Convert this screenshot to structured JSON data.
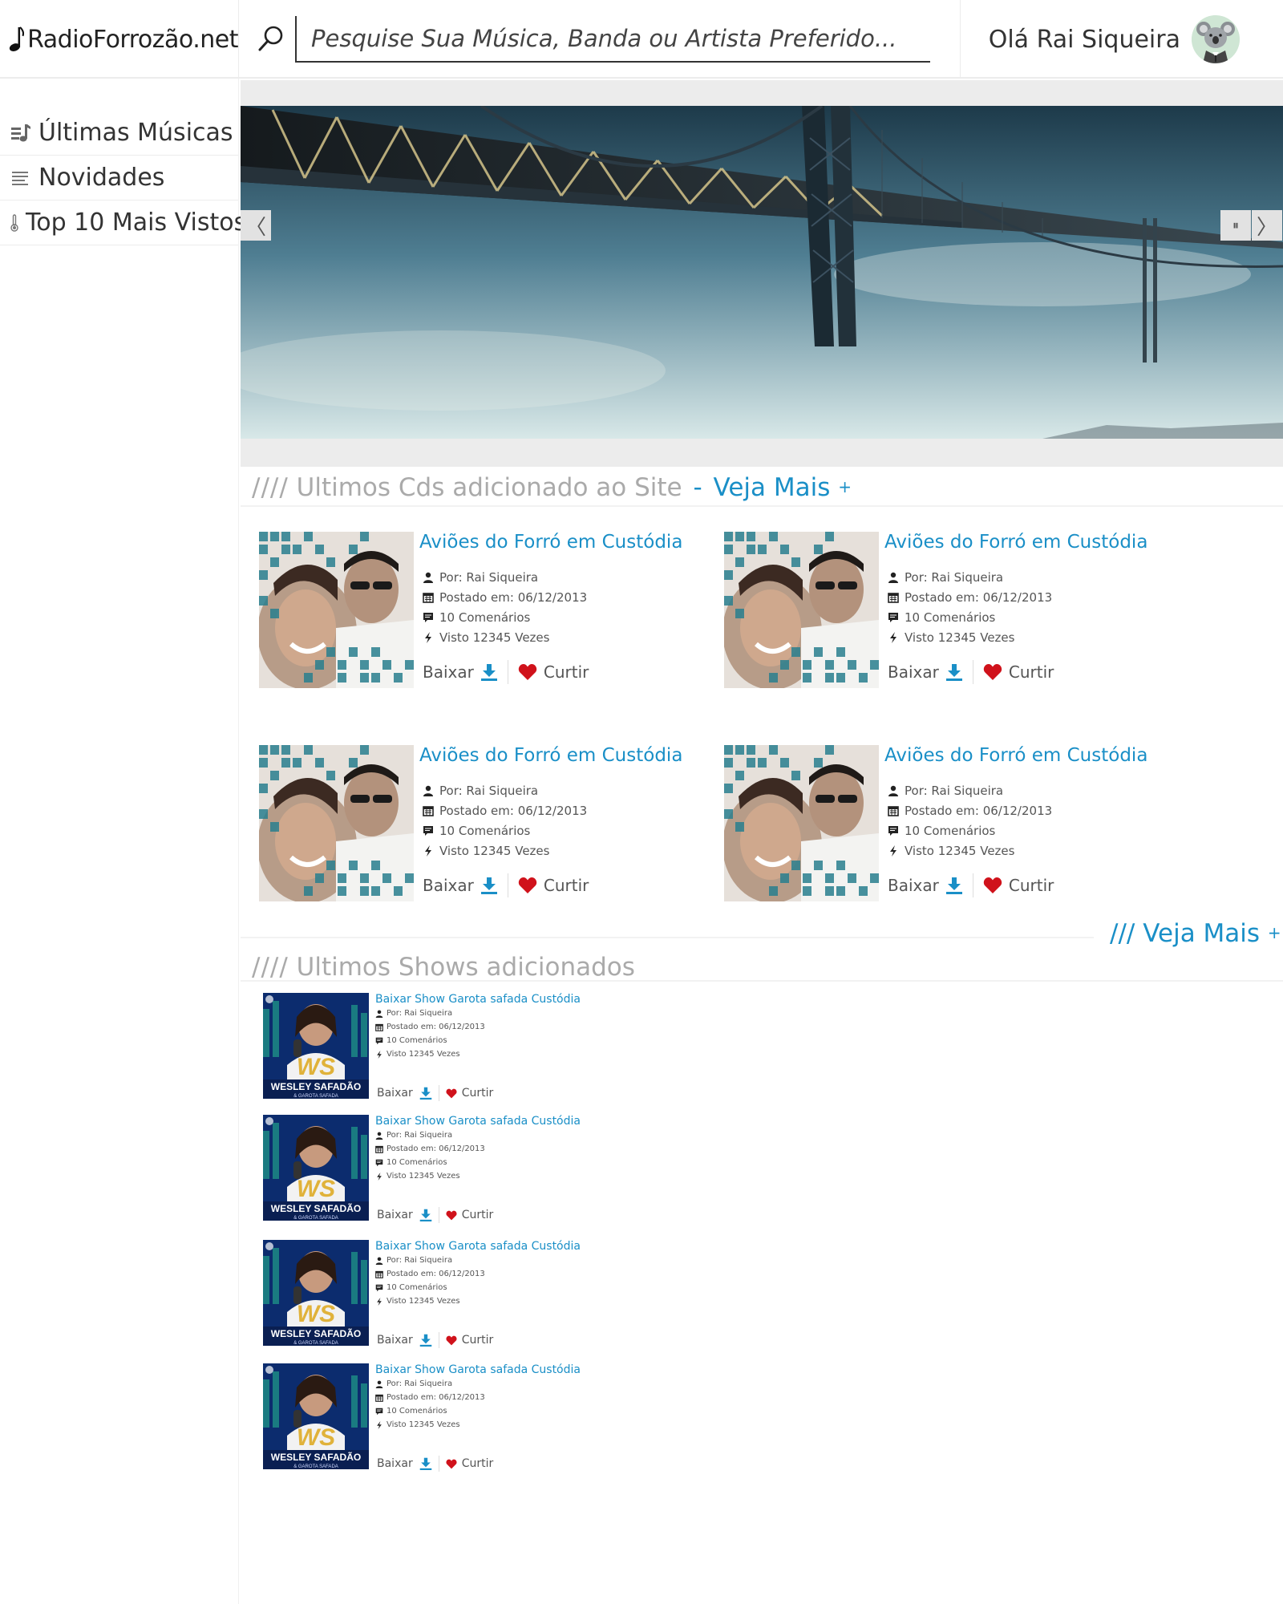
{
  "brand": {
    "name": "RadioForrozão.net",
    "note_icon": "music-note-icon"
  },
  "search": {
    "placeholder": "Pesquise Sua Música, Banda ou Artista Preferido..."
  },
  "user": {
    "greeting": "Olá Rai Siqueira"
  },
  "sidebar": {
    "items": [
      {
        "label": "Últimas Músicas",
        "icon": "music-list-icon"
      },
      {
        "label": "Novidades",
        "icon": "lines-icon"
      },
      {
        "label": "Top 10 Mais Vistos",
        "icon": "thermometer-icon"
      }
    ]
  },
  "slider": {
    "prev": "〈",
    "pause": "⏸",
    "next": "〉"
  },
  "cds_section": {
    "slashes": "////",
    "title": "Ultimos Cds adicionado ao Site",
    "dash": "-",
    "more_label": "Veja Mais",
    "plus": "+"
  },
  "cds": [
    {
      "title": "Aviões do Forró em Custódia",
      "author": "Por: Rai Siqueira",
      "date": "Postado em: 06/12/2013",
      "comments": "10 Comenários",
      "views": "Visto 12345 Vezes",
      "download": "Baixar",
      "like": "Curtir"
    },
    {
      "title": "Aviões do Forró em Custódia",
      "author": "Por: Rai Siqueira",
      "date": "Postado em: 06/12/2013",
      "comments": "10 Comenários",
      "views": "Visto 12345 Vezes",
      "download": "Baixar",
      "like": "Curtir"
    },
    {
      "title": "Aviões do Forró em Custódia",
      "author": "Por: Rai Siqueira",
      "date": "Postado em: 06/12/2013",
      "comments": "10 Comenários",
      "views": "Visto 12345 Vezes",
      "download": "Baixar",
      "like": "Curtir"
    },
    {
      "title": "Aviões do Forró em Custódia",
      "author": "Por: Rai Siqueira",
      "date": "Postado em: 06/12/2013",
      "comments": "10 Comenários",
      "views": "Visto 12345 Vezes",
      "download": "Baixar",
      "like": "Curtir"
    }
  ],
  "cds_more": {
    "slashes": "///",
    "label": "Veja Mais",
    "plus": "+"
  },
  "shows_section": {
    "slashes": "////",
    "title": "Ultimos Shows adicionados"
  },
  "show_cover": {
    "main": "WESLEY SAFADÃO",
    "sub": "& GAROTA SAFADA",
    "mono": "WS"
  },
  "shows": [
    {
      "title": "Baixar Show Garota safada Custódia",
      "author": "Por: Rai Siqueira",
      "date": "Postado em: 06/12/2013",
      "comments": "10 Comenários",
      "views": "Visto 12345 Vezes",
      "download": "Baixar",
      "like": "Curtir"
    },
    {
      "title": "Baixar Show Garota safada Custódia",
      "author": "Por: Rai Siqueira",
      "date": "Postado em: 06/12/2013",
      "comments": "10 Comenários",
      "views": "Visto 12345 Vezes",
      "download": "Baixar",
      "like": "Curtir"
    },
    {
      "title": "Baixar Show Garota safada Custódia",
      "author": "Por: Rai Siqueira",
      "date": "Postado em: 06/12/2013",
      "comments": "10 Comenários",
      "views": "Visto 12345 Vezes",
      "download": "Baixar",
      "like": "Curtir"
    },
    {
      "title": "Baixar Show Garota safada Custódia",
      "author": "Por: Rai Siqueira",
      "date": "Postado em: 06/12/2013",
      "comments": "10 Comenários",
      "views": "Visto 12345 Vezes",
      "download": "Baixar",
      "like": "Curtir"
    }
  ],
  "colors": {
    "accent": "#1a8fc7",
    "heart": "#d0121b",
    "muted": "#aaaaaa"
  }
}
